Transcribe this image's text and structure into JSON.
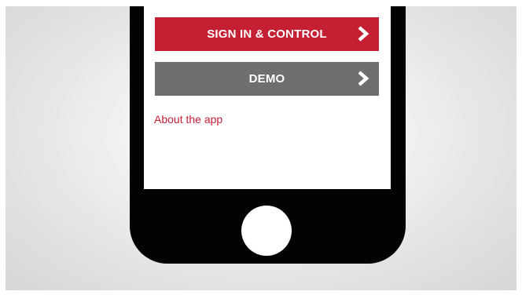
{
  "buttons": {
    "signin_label": "SIGN IN & CONTROL",
    "demo_label": "DEMO"
  },
  "links": {
    "about_label": "About the app"
  },
  "colors": {
    "brand_red": "#c51f33",
    "demo_gray": "#6e6e6e",
    "phone_black": "#030303"
  },
  "icons": {
    "button_chevron": "chevron-right-icon",
    "home": "home-button"
  }
}
